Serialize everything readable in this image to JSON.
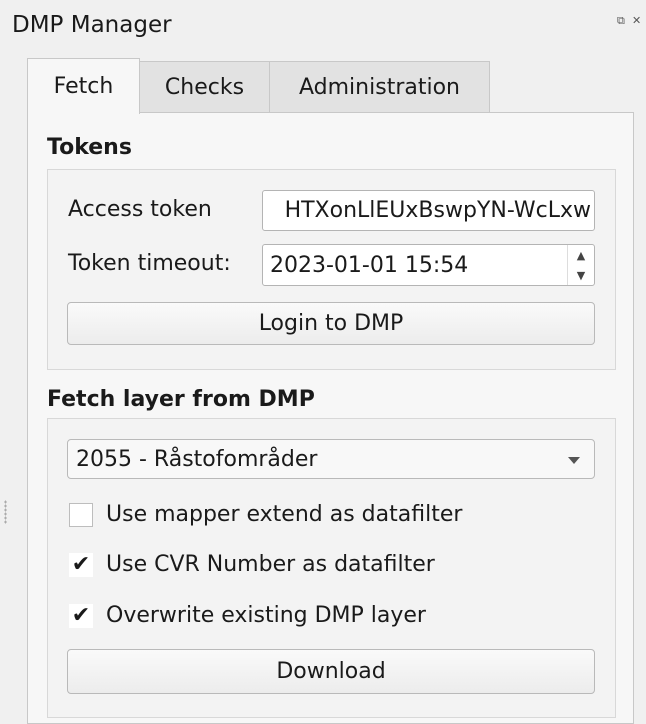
{
  "dock": {
    "title": "DMP Manager",
    "float_glyph": "⧉",
    "close_glyph": "✕"
  },
  "tabs": [
    {
      "label": "Fetch",
      "active": true
    },
    {
      "label": "Checks",
      "active": false
    },
    {
      "label": "Administration",
      "active": false
    }
  ],
  "tokens": {
    "section_title": "Tokens",
    "access_token_label": "Access token",
    "access_token_value": "HTXonLlEUxBswpYN-WcLxw",
    "timeout_label": "Token timeout:",
    "timeout_value": "2023-01-01 15:54",
    "login_button": "Login to DMP"
  },
  "fetch_layer": {
    "section_title": "Fetch layer from DMP",
    "layer_selected": "2055 - Råstofområder",
    "options": [
      {
        "label": "Use mapper extend as datafilter",
        "checked": false
      },
      {
        "label": "Use CVR Number as datafilter",
        "checked": true
      },
      {
        "label": "Overwrite existing DMP layer",
        "checked": true
      }
    ],
    "download_button": "Download"
  },
  "icons": {
    "check": "✔",
    "spin_up": "▲",
    "spin_down": "▼"
  }
}
